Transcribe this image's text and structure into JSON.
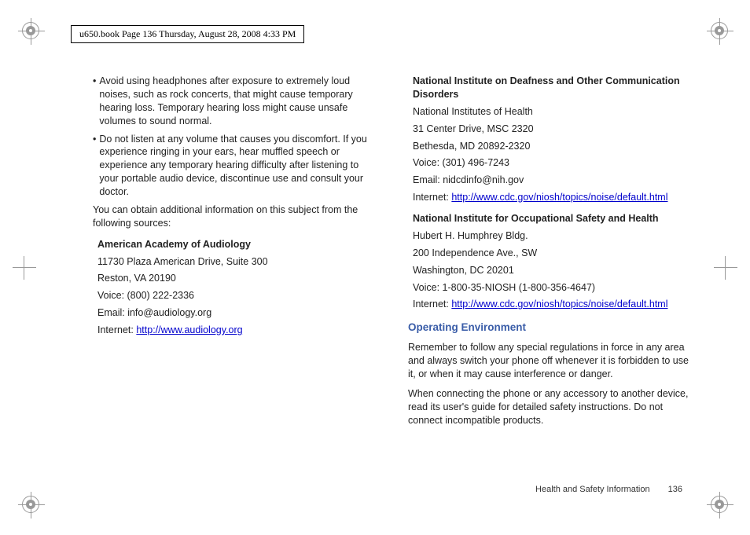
{
  "header": "u650.book  Page 136  Thursday, August 28, 2008  4:33 PM",
  "left": {
    "bullet1": "Avoid using headphones after exposure to extremely loud noises, such as rock concerts, that might cause temporary hearing loss. Temporary hearing loss might cause unsafe volumes to sound normal.",
    "bullet2": "Do not listen at any volume that causes you discomfort. If you experience ringing in your ears, hear muffled speech or experience any temporary hearing difficulty after listening to your portable audio device, discontinue use and consult your doctor.",
    "intro": "You can obtain additional information on this subject from the following sources:",
    "src1_title": "American Academy of Audiology",
    "src1_l1": "11730 Plaza American Drive, Suite 300",
    "src1_l2": "Reston, VA 20190",
    "src1_l3": "Voice: (800) 222-2336",
    "src1_l4": "Email: info@audiology.org",
    "src1_l5_label": "Internet: ",
    "src1_l5_link": "http://www.audiology.org"
  },
  "right": {
    "src2_title": "National Institute on Deafness and Other Communication Disorders",
    "src2_l1": "National Institutes of Health",
    "src2_l2": "31 Center Drive, MSC 2320",
    "src2_l3": "Bethesda, MD 20892-2320",
    "src2_l4": "Voice: (301) 496-7243",
    "src2_l5": "Email: nidcdinfo@nih.gov",
    "src2_l6_label": "Internet: ",
    "src2_l6_link": "http://www.cdc.gov/niosh/topics/noise/default.html",
    "src3_title": "National Institute for Occupational Safety and Health",
    "src3_l1": "Hubert H. Humphrey Bldg.",
    "src3_l2": "200 Independence Ave., SW",
    "src3_l3": "Washington, DC 20201",
    "src3_l4": "Voice: 1-800-35-NIOSH (1-800-356-4647)",
    "src3_l5_label": "Internet: ",
    "src3_l5_link": "http://www.cdc.gov/niosh/topics/noise/default.html",
    "section_title": "Operating Environment",
    "para1": "Remember to follow any special regulations in force in any area and always switch your phone off whenever it is forbidden to use it, or when it may cause interference or danger.",
    "para2": "When connecting the phone or any accessory to another device, read its user's guide for detailed safety instructions. Do not connect incompatible products."
  },
  "footer": {
    "label": "Health and Safety Information",
    "page": "136"
  }
}
